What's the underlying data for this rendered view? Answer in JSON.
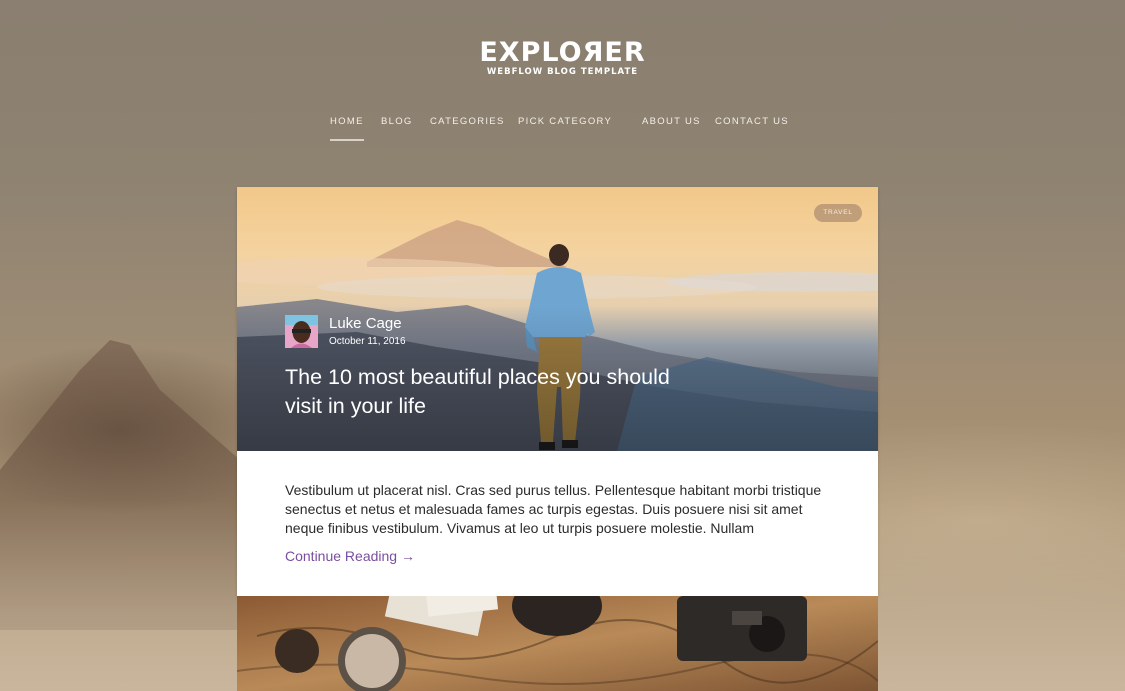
{
  "brand": {
    "title": "EXPLOЯER",
    "subtitle": "WEBFLOW BLOG TEMPLATE"
  },
  "nav": {
    "items": [
      {
        "label": "HOME",
        "active": true
      },
      {
        "label": "BLOG"
      },
      {
        "label": "CATEGORIES"
      },
      {
        "label": "PICK CATEGORY"
      },
      {
        "label": "ABOUT US"
      },
      {
        "label": "CONTACT US"
      }
    ]
  },
  "post": {
    "tag": "TRAVEL",
    "author": "Luke Cage",
    "date": "October 11, 2016",
    "title": "The 10 most beautiful places you should visit in your life",
    "excerpt": "Vestibulum ut placerat nisl. Cras sed purus tellus. Pellentesque habitant morbi tristique senectus et netus et malesuada fames ac turpis egestas. Duis posuere nisi sit amet neque finibus vestibulum. Vivamus at leo ut turpis posuere molestie. Nullam",
    "read_more": "Continue Reading →"
  },
  "colors": {
    "link": "#7a4e9e",
    "background": "#8d8170"
  }
}
